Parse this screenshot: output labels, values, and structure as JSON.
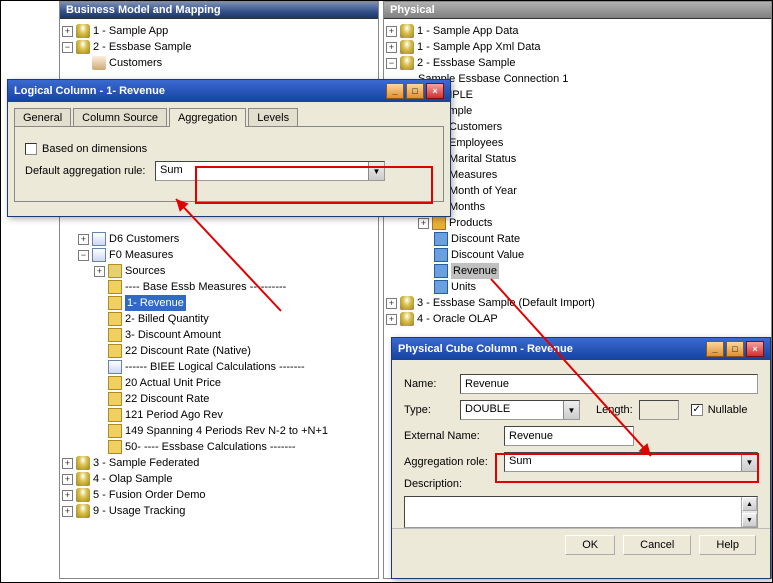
{
  "panes": {
    "bm": {
      "title": "Business Model and Mapping"
    },
    "phys": {
      "title": "Physical"
    }
  },
  "bm_tree": {
    "i1": "1 - Sample App",
    "i2": "2 - Essbase Sample",
    "i2a": "Customers",
    "d6": "D6 Customers",
    "f0": "F0 Measures",
    "src": "Sources",
    "base": "---- Base Essb Measures ----------",
    "rev": "1- Revenue",
    "bq": "2- Billed Quantity",
    "da": "3- Discount Amount",
    "drn": "22  Discount Rate (Native)",
    "biee": "------ BIEE Logical Calculations -------",
    "aup": "20  Actual Unit Price",
    "dr": "22  Discount Rate",
    "par": "121  Period Ago Rev",
    "span": "149  Spanning 4 Periods Rev N-2 to +N+1",
    "essb": "50- ---- Essbase Calculations -------",
    "sf": "3 - Sample Federated",
    "olap": "4 - Olap Sample",
    "fod": "5 - Fusion Order Demo",
    "ut": "9 - Usage Tracking"
  },
  "phys_tree": {
    "p1": "1 - Sample App Data",
    "p2": "1 - Sample App Xml Data",
    "p3": "2 - Essbase Sample",
    "conn": "Sample Essbase Connection 1",
    "bi": "BISAMPLE",
    "samp": "Sample",
    "cust": "Customers",
    "emp": "Employees",
    "ms": "Marital Status",
    "meas": "Measures",
    "moy": "Month of Year",
    "mon": "Months",
    "prod": "Products",
    "drate": "Discount Rate",
    "dval": "Discount Value",
    "rev": "Revenue",
    "units": "Units",
    "p4": "3 - Essbase Sample (Default Import)",
    "p5": "4 - Oracle OLAP"
  },
  "dlg1": {
    "title": "Logical Column - 1- Revenue",
    "tabs": {
      "general": "General",
      "colsrc": "Column Source",
      "agg": "Aggregation",
      "levels": "Levels"
    },
    "based": "Based on dimensions",
    "def_label": "Default aggregation rule:",
    "def_value": "Sum"
  },
  "dlg2": {
    "title": "Physical Cube Column - Revenue",
    "name_label": "Name:",
    "name_value": "Revenue",
    "type_label": "Type:",
    "type_value": "DOUBLE",
    "length_label": "Length:",
    "length_value": "",
    "nullable_label": "Nullable",
    "ext_label": "External Name:",
    "ext_value": "Revenue",
    "agg_label": "Aggregation role:",
    "agg_value": "Sum",
    "desc_label": "Description:",
    "btn_ok": "OK",
    "btn_cancel": "Cancel",
    "btn_help": "Help"
  }
}
